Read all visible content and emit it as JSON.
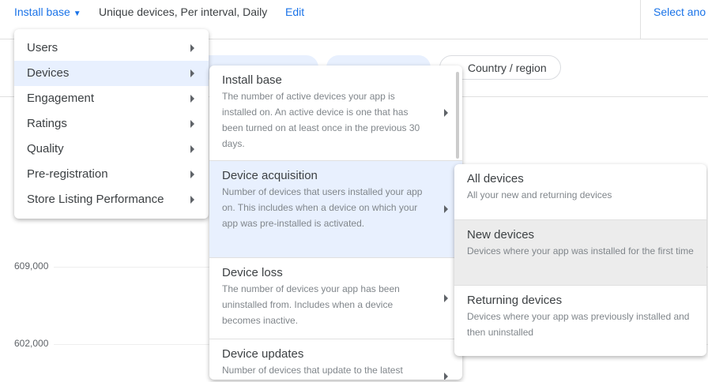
{
  "header": {
    "metric": "Install base",
    "summary": "Unique devices, Per interval, Daily",
    "edit": "Edit",
    "select_another": "Select ano"
  },
  "filters": {
    "chip_country": "Country / region"
  },
  "chart": {
    "y_ticks": [
      "609,000",
      "602,000"
    ]
  },
  "menu1": {
    "items": [
      {
        "label": "Users"
      },
      {
        "label": "Devices"
      },
      {
        "label": "Engagement"
      },
      {
        "label": "Ratings"
      },
      {
        "label": "Quality"
      },
      {
        "label": "Pre-registration"
      },
      {
        "label": "Store Listing Performance"
      }
    ]
  },
  "menu2": {
    "items": [
      {
        "title": "Install base",
        "desc": "The number of active devices your app is installed on. An active device is one that has been turned on at least once in the previous 30 days."
      },
      {
        "title": "Device acquisition",
        "desc": "Number of devices that users installed your app on. This includes when a device on which your app was pre-installed is activated."
      },
      {
        "title": "Device loss",
        "desc": "The number of devices your app has been uninstalled from. Includes when a device becomes inactive."
      },
      {
        "title": "Device updates",
        "desc": "Number of devices that update to the latest"
      }
    ]
  },
  "menu3": {
    "items": [
      {
        "title": "All devices",
        "desc": "All your new and returning devices"
      },
      {
        "title": "New devices",
        "desc": "Devices where your app was installed for the first time"
      },
      {
        "title": "Returning devices",
        "desc": "Devices where your app was previously installed and then uninstalled"
      }
    ]
  },
  "colors": {
    "accent": "#1a73e8",
    "active_bg": "#e8f0fe",
    "hover_bg": "#ececec"
  }
}
